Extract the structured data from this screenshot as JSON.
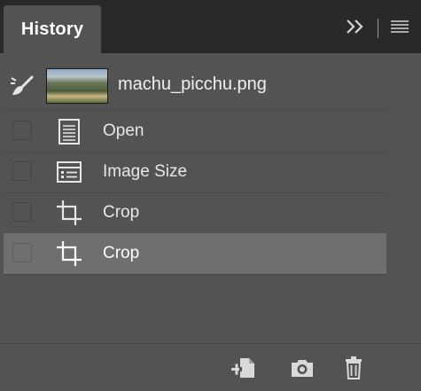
{
  "panel": {
    "tab_label": "History",
    "header_icons": [
      "collapse-chevrons-icon",
      "panel-menu-icon"
    ]
  },
  "snapshot": {
    "name": "machu_picchu.png",
    "icon": "history-brush-icon"
  },
  "states": [
    {
      "label": "Open",
      "icon": "document-icon",
      "selected": false
    },
    {
      "label": "Image Size",
      "icon": "image-size-icon",
      "selected": false
    },
    {
      "label": "Crop",
      "icon": "crop-icon",
      "selected": false
    },
    {
      "label": "Crop",
      "icon": "crop-icon",
      "selected": true
    }
  ],
  "toolbar": {
    "buttons": [
      "new-document-from-state-icon",
      "camera-icon",
      "trash-icon"
    ]
  },
  "colors": {
    "panel_bg": "#535353",
    "header_bg": "#292929",
    "selected_row": "#6f6f6f",
    "text": "#e8e8e8"
  }
}
